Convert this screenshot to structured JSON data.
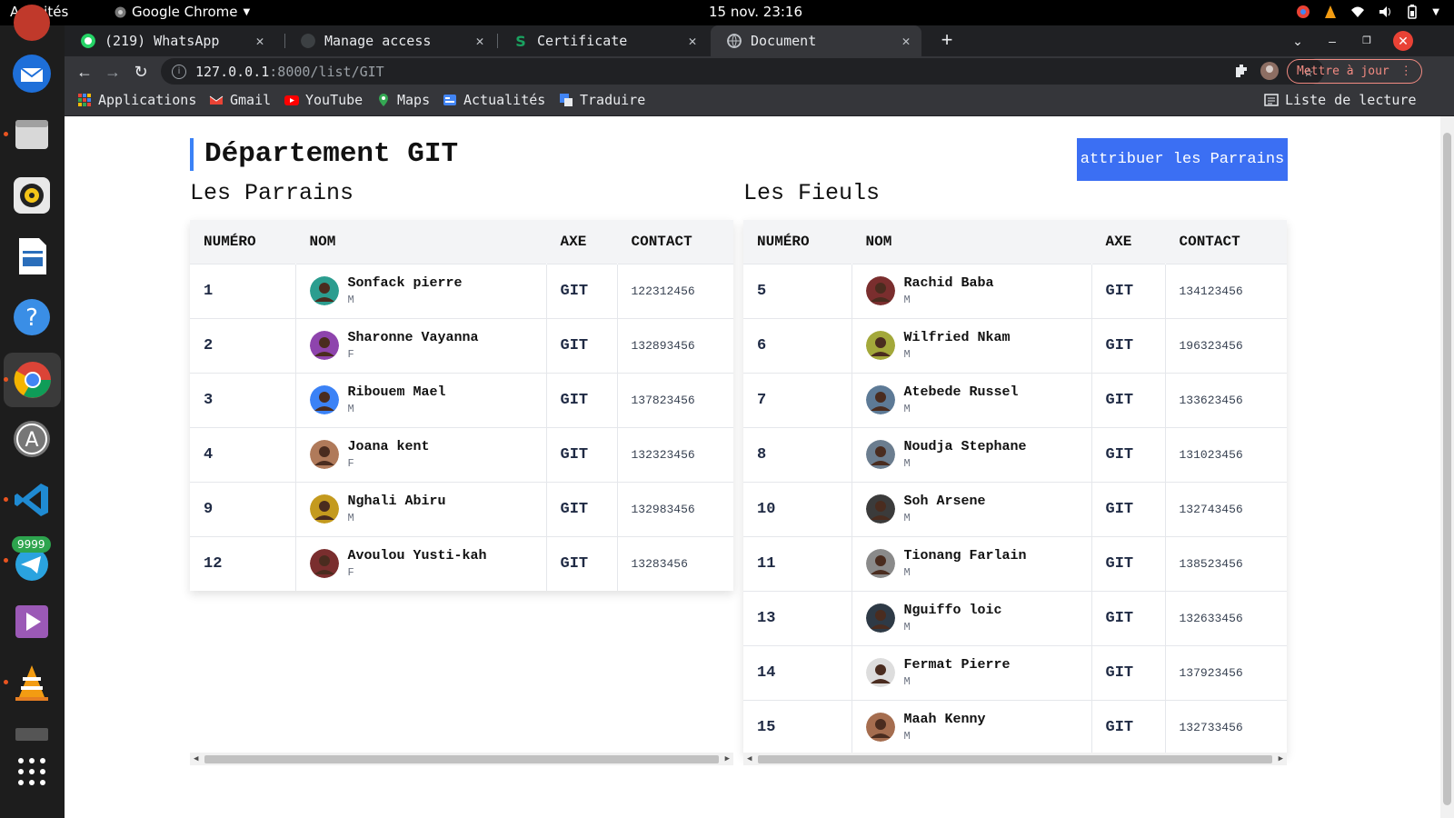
{
  "topbar": {
    "activities": "Activités",
    "app": "Google Chrome",
    "clock": "15 nov.  23:16"
  },
  "tabs": [
    {
      "title": "(219) WhatsApp",
      "color": "#25d366"
    },
    {
      "title": "Manage access",
      "color": "#3c4043"
    },
    {
      "title": "Certificate",
      "color": "#1aa260"
    },
    {
      "title": "Document",
      "color": "#bdc1c6"
    }
  ],
  "toolbar": {
    "url_host": "127.0.0.1",
    "url_path": ":8000/list/GIT",
    "update_label": "Mettre à jour"
  },
  "bookmarks": [
    {
      "label": "Applications",
      "color": "#4285f4"
    },
    {
      "label": "Gmail",
      "color": "#ea4335"
    },
    {
      "label": "YouTube",
      "color": "#ff0000"
    },
    {
      "label": "Maps",
      "color": "#34a853"
    },
    {
      "label": "Actualités",
      "color": "#4285f4"
    },
    {
      "label": "Traduire",
      "color": "#4285f4"
    }
  ],
  "reading_list": "Liste de lecture",
  "dock": {
    "telegram_badge": "9999"
  },
  "page": {
    "title": "Département GIT",
    "assign_button": "attribuer les Parrains",
    "parrains": {
      "title": "Les Parrains",
      "headers": [
        "NUMÉRO",
        "NOM",
        "AXE",
        "CONTACT"
      ],
      "rows": [
        {
          "num": "1",
          "name": "Sonfack pierre",
          "sex": "M",
          "axe": "GIT",
          "contact": "122312456"
        },
        {
          "num": "2",
          "name": "Sharonne Vayanna",
          "sex": "F",
          "axe": "GIT",
          "contact": "132893456"
        },
        {
          "num": "3",
          "name": "Ribouem Mael",
          "sex": "M",
          "axe": "GIT",
          "contact": "137823456"
        },
        {
          "num": "4",
          "name": "Joana kent",
          "sex": "F",
          "axe": "GIT",
          "contact": "132323456"
        },
        {
          "num": "9",
          "name": "Nghali Abiru",
          "sex": "M",
          "axe": "GIT",
          "contact": "132983456"
        },
        {
          "num": "12",
          "name": "Avoulou Yusti-kah",
          "sex": "F",
          "axe": "GIT",
          "contact": "13283456"
        }
      ]
    },
    "fieuls": {
      "title": "Les Fieuls",
      "headers": [
        "NUMÉRO",
        "NOM",
        "AXE",
        "CONTACT"
      ],
      "rows": [
        {
          "num": "5",
          "name": "Rachid Baba",
          "sex": "M",
          "axe": "GIT",
          "contact": "134123456"
        },
        {
          "num": "6",
          "name": "Wilfried Nkam",
          "sex": "M",
          "axe": "GIT",
          "contact": "196323456"
        },
        {
          "num": "7",
          "name": "Atebede Russel",
          "sex": "M",
          "axe": "GIT",
          "contact": "133623456"
        },
        {
          "num": "8",
          "name": "Noudja Stephane",
          "sex": "M",
          "axe": "GIT",
          "contact": "131023456"
        },
        {
          "num": "10",
          "name": "Soh Arsene",
          "sex": "M",
          "axe": "GIT",
          "contact": "132743456"
        },
        {
          "num": "11",
          "name": "Tionang Farlain",
          "sex": "M",
          "axe": "GIT",
          "contact": "138523456"
        },
        {
          "num": "13",
          "name": "Nguiffo loic",
          "sex": "M",
          "axe": "GIT",
          "contact": "132633456"
        },
        {
          "num": "14",
          "name": "Fermat Pierre",
          "sex": "M",
          "axe": "GIT",
          "contact": "137923456"
        },
        {
          "num": "15",
          "name": "Maah Kenny",
          "sex": "M",
          "axe": "GIT",
          "contact": "132733456"
        }
      ]
    }
  },
  "colors": {
    "accent": "#3b6ff3",
    "update": "#f28b82"
  }
}
